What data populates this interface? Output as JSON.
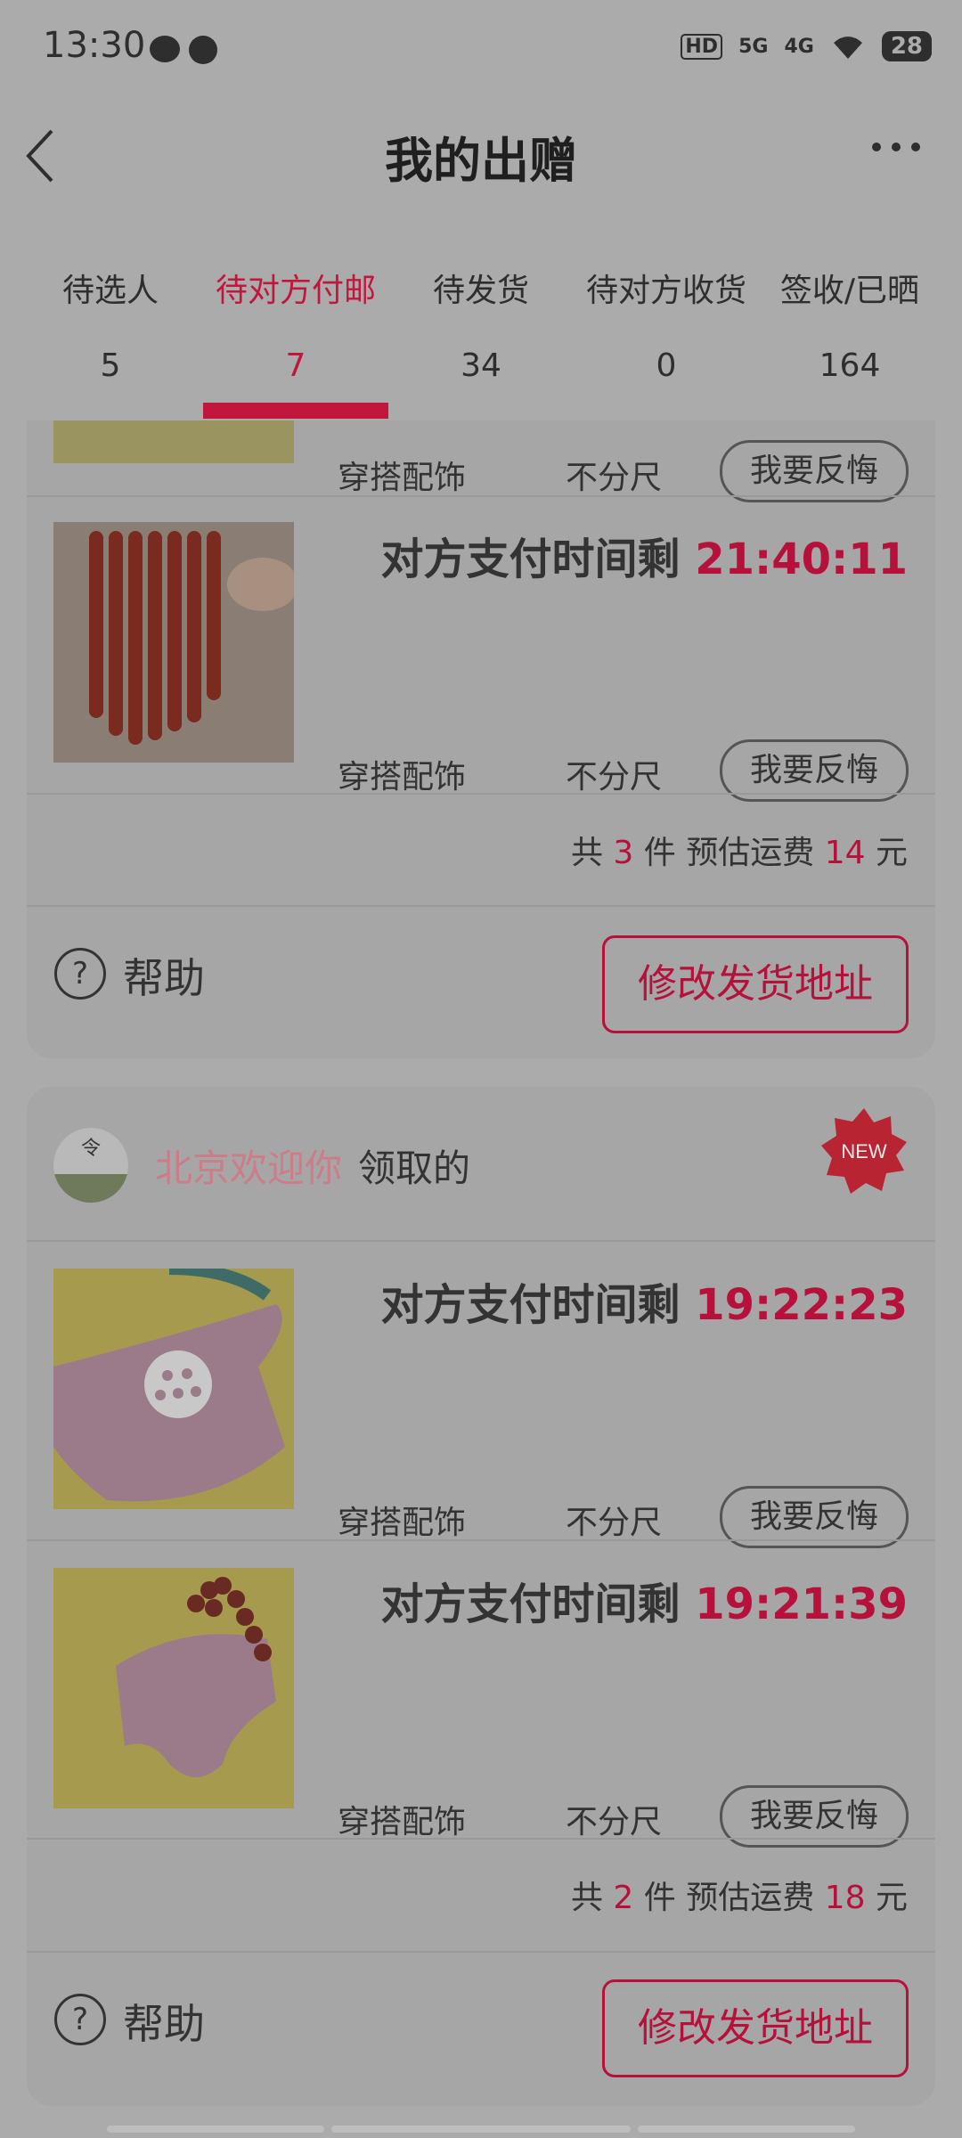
{
  "status_bar": {
    "time": "13:30",
    "network": [
      "HD",
      "5G",
      "4G"
    ],
    "battery": "28"
  },
  "header": {
    "title": "我的出赠"
  },
  "tabs": [
    {
      "label": "待选人",
      "count": "5"
    },
    {
      "label": "待对方付邮",
      "count": "7",
      "active": true
    },
    {
      "label": "待发货",
      "count": "34"
    },
    {
      "label": "待对方收货",
      "count": "0"
    },
    {
      "label": "签收/已晒",
      "count": "164"
    }
  ],
  "card1": {
    "partial_item": {
      "category": "穿搭配饰",
      "size": "不分尺",
      "regret_label": "我要反悔"
    },
    "item": {
      "timer_label": "对方支付时间剩",
      "timer": "21:40:11",
      "category": "穿搭配饰",
      "size": "不分尺",
      "regret_label": "我要反悔"
    },
    "summary": {
      "prefix": "共",
      "count": "3",
      "unit": "件",
      "fee_label": "预估运费",
      "fee": "14",
      "currency": "元"
    },
    "help_label": "帮助",
    "address_button": "修改发货地址"
  },
  "card2": {
    "claimant": "北京欢迎你",
    "claim_suffix": "领取的",
    "badge": "NEW",
    "items": [
      {
        "timer_label": "对方支付时间剩",
        "timer": "19:22:23",
        "category": "穿搭配饰",
        "size": "不分尺",
        "regret_label": "我要反悔"
      },
      {
        "timer_label": "对方支付时间剩",
        "timer": "19:21:39",
        "category": "穿搭配饰",
        "size": "不分尺",
        "regret_label": "我要反悔"
      }
    ],
    "summary": {
      "prefix": "共",
      "count": "2",
      "unit": "件",
      "fee_label": "预估运费",
      "fee": "18",
      "currency": "元"
    },
    "help_label": "帮助",
    "address_button": "修改发货地址"
  },
  "colors": {
    "accent": "#c2173d",
    "overlay_bg": "#ababab",
    "card_bg": "#a6a6a6"
  }
}
